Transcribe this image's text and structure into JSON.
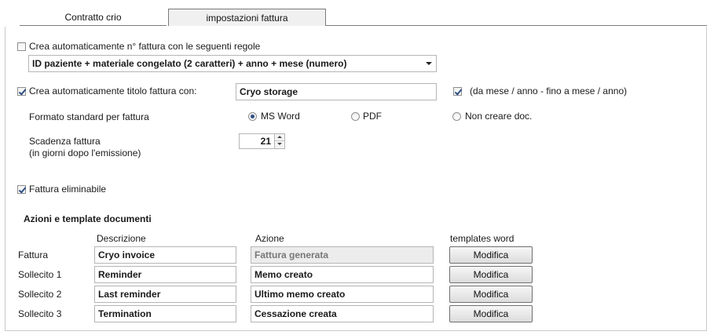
{
  "tabs": [
    {
      "label": "Contratto crio"
    },
    {
      "label": "impostazioni fattura"
    }
  ],
  "auto_number": {
    "checkbox_label": "Crea automaticamente n° fattura con le seguenti regole",
    "checked": false,
    "rule_selected": "ID paziente + materiale congelato (2 caratteri) + anno + mese (numero)"
  },
  "auto_title": {
    "checkbox_label": "Crea automaticamente titolo fattura con:",
    "checked": true,
    "value": "Cryo storage",
    "period_label": "(da mese / anno - fino a mese / anno)",
    "period_checked": true
  },
  "format": {
    "label": "Formato standard per fattura",
    "options": [
      "MS Word",
      "PDF",
      "Non creare doc."
    ],
    "selected": "MS Word"
  },
  "due": {
    "label_line1": "Scadenza fattura",
    "label_line2": "(in giorni dopo l'emissione)",
    "value": "21"
  },
  "deletable": {
    "label": "Fattura eliminabile",
    "checked": true
  },
  "actions": {
    "section_title": "Azioni e template documenti",
    "col_description": "Descrizione",
    "col_action": "Azione",
    "col_templates": "templates word",
    "rows": [
      {
        "type": "Fattura",
        "description": "Cryo invoice",
        "action": "Fattura generata",
        "action_disabled": true,
        "button": "Modifica"
      },
      {
        "type": "Sollecito 1",
        "description": "Reminder",
        "action": "Memo creato",
        "action_disabled": false,
        "button": "Modifica"
      },
      {
        "type": "Sollecito 2",
        "description": "Last reminder",
        "action": "Ultimo memo creato",
        "action_disabled": false,
        "button": "Modifica"
      },
      {
        "type": "Sollecito 3",
        "description": "Termination",
        "action": "Cessazione creata",
        "action_disabled": false,
        "button": "Modifica"
      }
    ]
  }
}
